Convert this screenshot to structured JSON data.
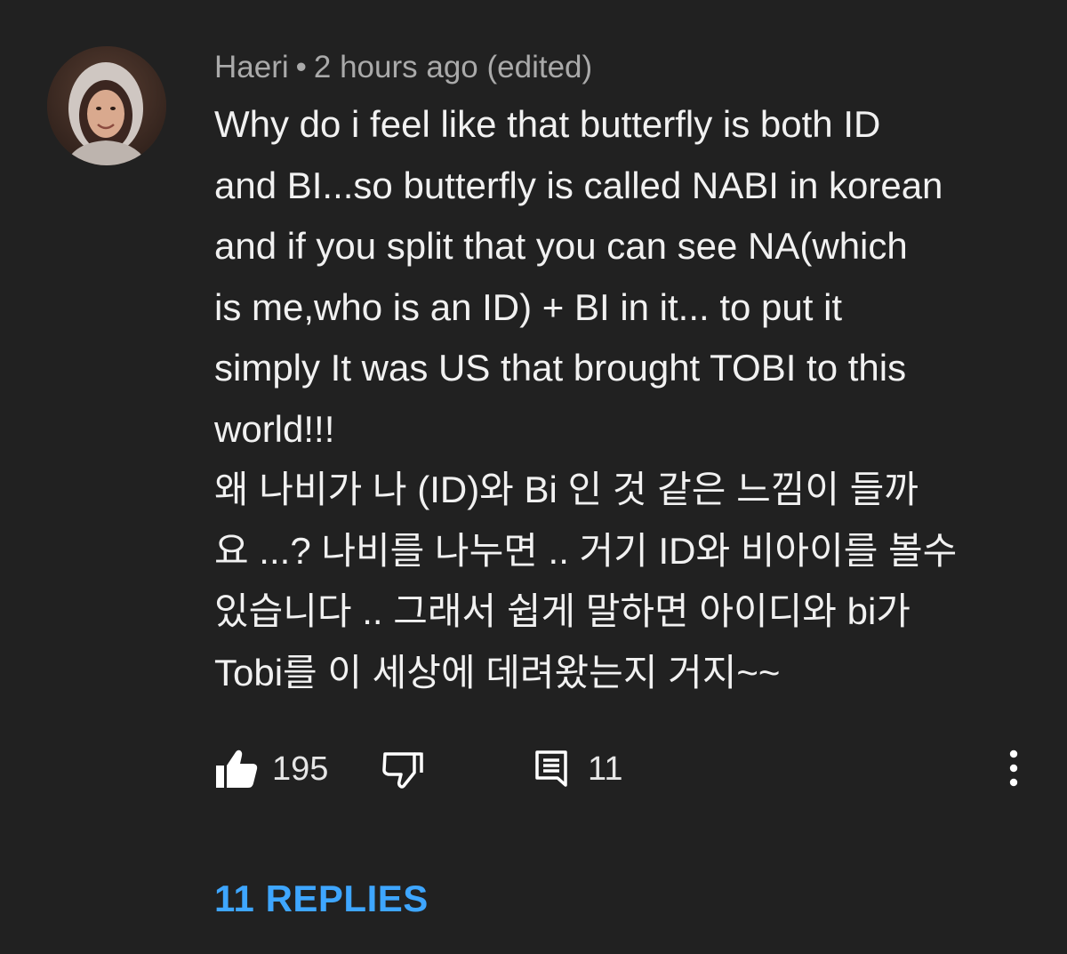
{
  "comment": {
    "author": "Haeri",
    "separator": "•",
    "timestamp": "2 hours ago (edited)",
    "body_lines": [
      "Why do i feel like that butterfly is both ID",
      "and BI...so butterfly is called NABI in korean",
      "and if you split that you can see NA(which",
      "is me,who is an ID) + BI in it... to put it",
      "simply It was US that brought TOBI to this",
      "world!!!",
      "왜 나비가 나 (ID)와 Bi 인 것 같은 느낌이 들까",
      "요 ...? 나비를 나누면 .. 거기 ID와 비아이를 볼수",
      "있습니다 .. 그래서 쉽게 말하면 아이디와 bi가",
      "Tobi를 이 세상에 데려왔는지 거지~~"
    ],
    "actions": {
      "like_count": "195",
      "reply_count": "11",
      "like_icon": "thumbs-up-icon",
      "dislike_icon": "thumbs-down-icon",
      "reply_icon": "comment-reply-icon",
      "menu_icon": "more-vertical-icon"
    },
    "view_replies_label": "11 REPLIES"
  },
  "colors": {
    "background": "#212121",
    "meta_text": "#aaaaaa",
    "body_text": "#f1f1f1",
    "link": "#3ea6ff"
  }
}
